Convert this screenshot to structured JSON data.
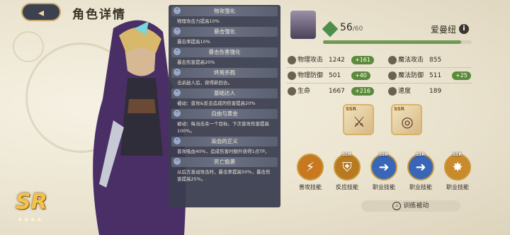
{
  "header": {
    "title": "角色详情",
    "back_icon": "back-arrow-icon"
  },
  "hero": {
    "rarity": "SR",
    "stars": "★★★★",
    "name": "爱曼纽"
  },
  "level": {
    "current": "56",
    "max": "/60",
    "exp_fraction": 0.93
  },
  "stats": [
    {
      "label": "物理攻击",
      "value": "1242",
      "bonus": "+161",
      "icon": "sword-icon"
    },
    {
      "label": "魔法攻击",
      "value": "855",
      "bonus": "",
      "icon": "magic-icon"
    },
    {
      "label": "物理防御",
      "value": "501",
      "bonus": "+40",
      "icon": "shield-icon"
    },
    {
      "label": "魔法防御",
      "value": "511",
      "bonus": "+25",
      "icon": "magic-shield-icon"
    },
    {
      "label": "生命",
      "value": "1667",
      "bonus": "+216",
      "icon": "heart-icon"
    },
    {
      "label": "速度",
      "value": "189",
      "bonus": "",
      "icon": "boot-icon"
    }
  ],
  "equipment": [
    {
      "tag": "SSR",
      "icon": "dagger-icon"
    },
    {
      "tag": "SSR",
      "icon": "ring-icon"
    }
  ],
  "skill_list": [
    {
      "name": "物攻强化",
      "desc": "物理攻击力提高10%"
    },
    {
      "name": "暴击强化",
      "desc": "暴击率提高10%"
    },
    {
      "name": "暴击伤害强化",
      "desc": "暴击伤害提高20%"
    },
    {
      "name": "终焉杀戮",
      "desc": "击杀敌人后，获得新回合。"
    },
    {
      "name": "基础达人",
      "desc": "被动：普攻&反击造成的伤害提高20%"
    },
    {
      "name": "自由与黄金",
      "desc": "被动：每当击杀一个目标，下次普攻伤害提高100%。"
    },
    {
      "name": "染血的正义",
      "desc": "普攻吸血40%，造成伤害时额外获得1点TP。"
    },
    {
      "name": "死亡偷袭",
      "desc": "从后方发动攻击时，暴击率提高50%，暴击伤害提高25%。"
    }
  ],
  "skill_buttons": [
    {
      "label": "普攻技能",
      "tag": "",
      "color": "#c8781e"
    },
    {
      "label": "反应技能",
      "tag": "SSR",
      "color": "#b87a20"
    },
    {
      "label": "职业技能",
      "tag": "SSR",
      "color": "#3a66b8"
    },
    {
      "label": "职业技能",
      "tag": "SSR",
      "color": "#3a66b8"
    },
    {
      "label": "职业技能",
      "tag": "SSR",
      "color": "#c88a2a"
    }
  ],
  "passive_button": {
    "label": "训练被动"
  }
}
